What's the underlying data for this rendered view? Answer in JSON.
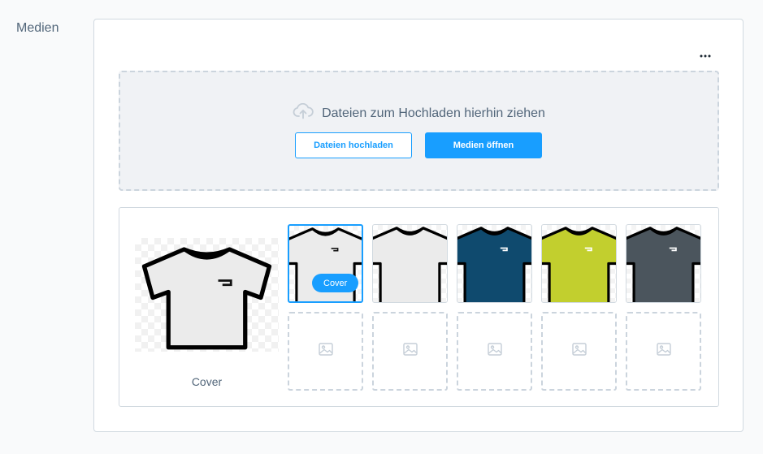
{
  "section": {
    "label": "Medien"
  },
  "toolbar": {
    "more_icon": "more-horizontal-icon"
  },
  "upload": {
    "title": "Dateien zum Hochladen hierhin ziehen",
    "icon": "cloud-upload-icon",
    "upload_button": "Dateien hochladen",
    "open_media_button": "Medien öffnen"
  },
  "gallery": {
    "cover_caption": "Cover",
    "cover_badge": "Cover",
    "thumbnails": [
      {
        "name": "tshirt-white-logo",
        "color": "#ebebeb",
        "logo": "#111111",
        "selected": true
      },
      {
        "name": "tshirt-white-plain",
        "color": "#ebebeb",
        "logo": null,
        "selected": false
      },
      {
        "name": "tshirt-navy",
        "color": "#0f4a6e",
        "logo": "#ffffff",
        "selected": false
      },
      {
        "name": "tshirt-lime",
        "color": "#c2cf2e",
        "logo": "#ffffff",
        "selected": false
      },
      {
        "name": "tshirt-slate",
        "color": "#4b555d",
        "logo": "#ffffff",
        "selected": false
      }
    ],
    "placeholders": 5,
    "placeholder_icon": "image-placeholder-icon"
  },
  "colors": {
    "primary": "#189eff",
    "border": "#d1d9e0",
    "text": "#52667a",
    "dropzone_bg": "#f0f2f5"
  }
}
